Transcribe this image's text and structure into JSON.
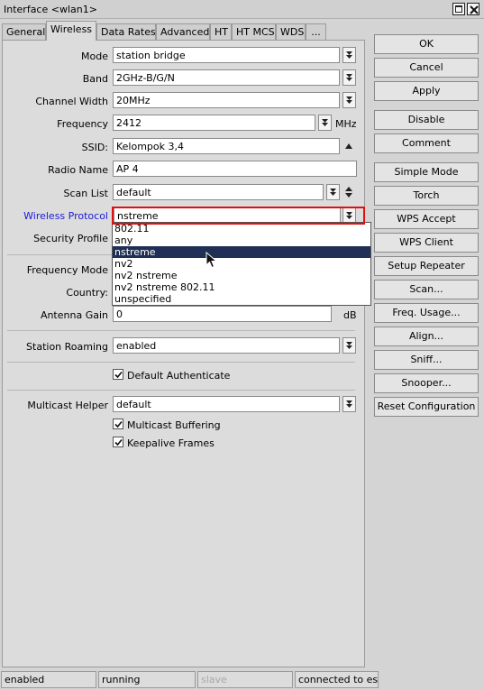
{
  "window": {
    "title": "Interface <wlan1>"
  },
  "tabs": [
    {
      "label": "General"
    },
    {
      "label": "Wireless"
    },
    {
      "label": "Data Rates"
    },
    {
      "label": "Advanced"
    },
    {
      "label": "HT"
    },
    {
      "label": "HT MCS"
    },
    {
      "label": "WDS"
    },
    {
      "label": "..."
    }
  ],
  "form": {
    "mode": {
      "label": "Mode",
      "value": "station bridge"
    },
    "band": {
      "label": "Band",
      "value": "2GHz-B/G/N"
    },
    "channel_width": {
      "label": "Channel Width",
      "value": "20MHz"
    },
    "frequency": {
      "label": "Frequency",
      "value": "2412",
      "unit": "MHz"
    },
    "ssid": {
      "label": "SSID:",
      "value": "Kelompok 3,4"
    },
    "radio_name": {
      "label": "Radio Name",
      "value": "AP 4"
    },
    "scan_list": {
      "label": "Scan List",
      "value": "default"
    },
    "wireless_protocol": {
      "label": "Wireless Protocol",
      "value": "nstreme"
    },
    "security_profile": {
      "label": "Security Profile"
    },
    "frequency_mode": {
      "label": "Frequency Mode"
    },
    "country": {
      "label": "Country:"
    },
    "antenna_gain": {
      "label": "Antenna Gain",
      "value": "0",
      "unit": "dB"
    },
    "station_roaming": {
      "label": "Station Roaming",
      "value": "enabled"
    },
    "default_authenticate": {
      "label": "Default Authenticate",
      "checked": true
    },
    "multicast_helper": {
      "label": "Multicast Helper",
      "value": "default"
    },
    "multicast_buffering": {
      "label": "Multicast Buffering",
      "checked": true
    },
    "keepalive_frames": {
      "label": "Keepalive Frames",
      "checked": true
    }
  },
  "protocol_dropdown": {
    "options": [
      "802.11",
      "any",
      "nstreme",
      "nv2",
      "nv2 nstreme",
      "nv2 nstreme 802.11",
      "unspecified"
    ],
    "selected": "nstreme"
  },
  "buttons": {
    "ok": "OK",
    "cancel": "Cancel",
    "apply": "Apply",
    "disable": "Disable",
    "comment": "Comment",
    "simple_mode": "Simple Mode",
    "torch": "Torch",
    "wps_accept": "WPS Accept",
    "wps_client": "WPS Client",
    "setup_repeater": "Setup Repeater",
    "scan": "Scan...",
    "freq_usage": "Freq. Usage...",
    "align": "Align...",
    "sniff": "Sniff...",
    "snooper": "Snooper...",
    "reset_configuration": "Reset Configuration"
  },
  "status": {
    "state": "enabled",
    "running": "running",
    "slave": "slave",
    "connection": "connected to es"
  }
}
